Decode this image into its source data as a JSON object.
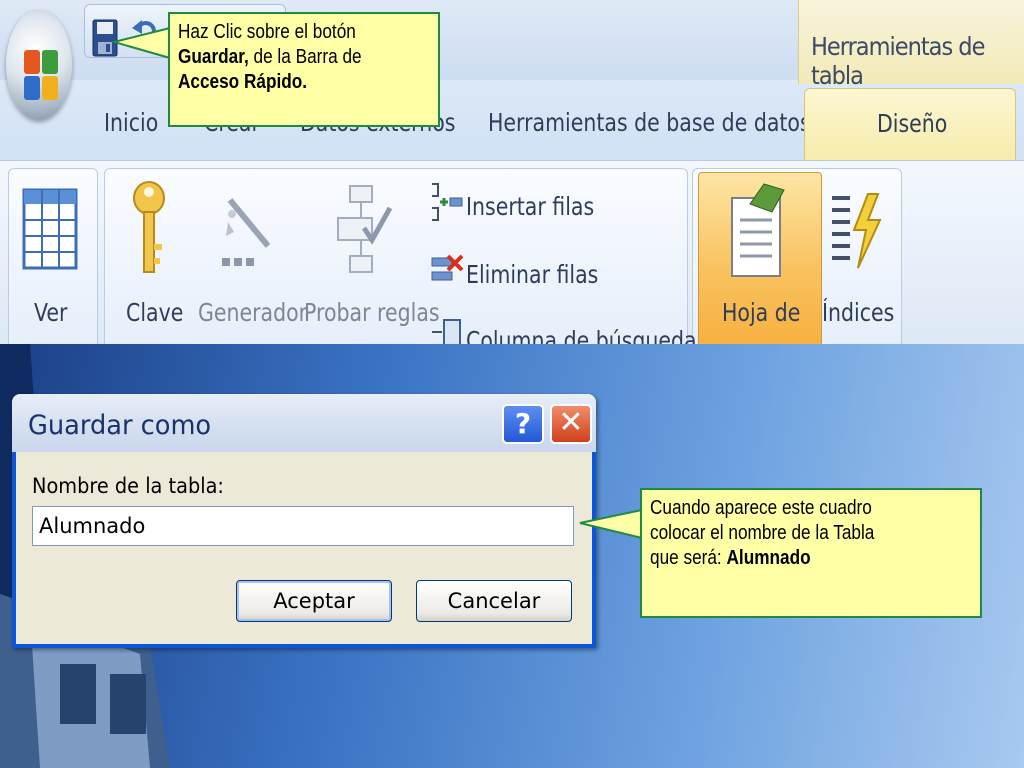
{
  "ribbon": {
    "context_group_label": "Herramientas de tabla",
    "tabs": [
      {
        "label": "Inicio"
      },
      {
        "label": "Crear"
      },
      {
        "label": "Datos externos"
      },
      {
        "label": "Herramientas de base de datos"
      },
      {
        "label": "Diseño"
      }
    ],
    "buttons": {
      "ver": "Ver",
      "clave": "Clave",
      "generador": "Generador",
      "probar_reglas": "Probar reglas",
      "insertar_filas": "Insertar filas",
      "eliminar_filas": "Eliminar filas",
      "columna_busqueda": "Columna de búsqueda",
      "hoja_de": "Hoja de",
      "indices": "Índices"
    }
  },
  "callout_1": {
    "line1": "Haz Clic sobre el botón",
    "bold1": "Guardar,",
    "line2_rest": " de la Barra  de",
    "bold2": "Acceso Rápido."
  },
  "dialog": {
    "title": "Guardar como",
    "help_glyph": "?",
    "close_glyph": "✕",
    "field_label": "Nombre de la tabla:",
    "field_value": "Alumnado",
    "accept_label": "Aceptar",
    "cancel_label": "Cancelar"
  },
  "callout_2": {
    "line1": "Cuando aparece este cuadro",
    "line2": "colocar el nombre de la Tabla",
    "line3_prefix": "que será: ",
    "bold": "Alumnado"
  },
  "colors": {
    "callout_fill": "#ffffa6",
    "callout_border": "#1f8a46",
    "dialog_frame": "#0a56d8",
    "context_tab": "#f6ebaa"
  },
  "icons": [
    "office-button-icon",
    "save-icon",
    "undo-icon",
    "datasheet-view-icon",
    "key-icon",
    "builder-icon",
    "test-rules-icon",
    "insert-rows-icon",
    "delete-rows-icon",
    "lookup-column-icon",
    "property-sheet-icon",
    "indexes-icon",
    "help-icon",
    "close-icon"
  ]
}
